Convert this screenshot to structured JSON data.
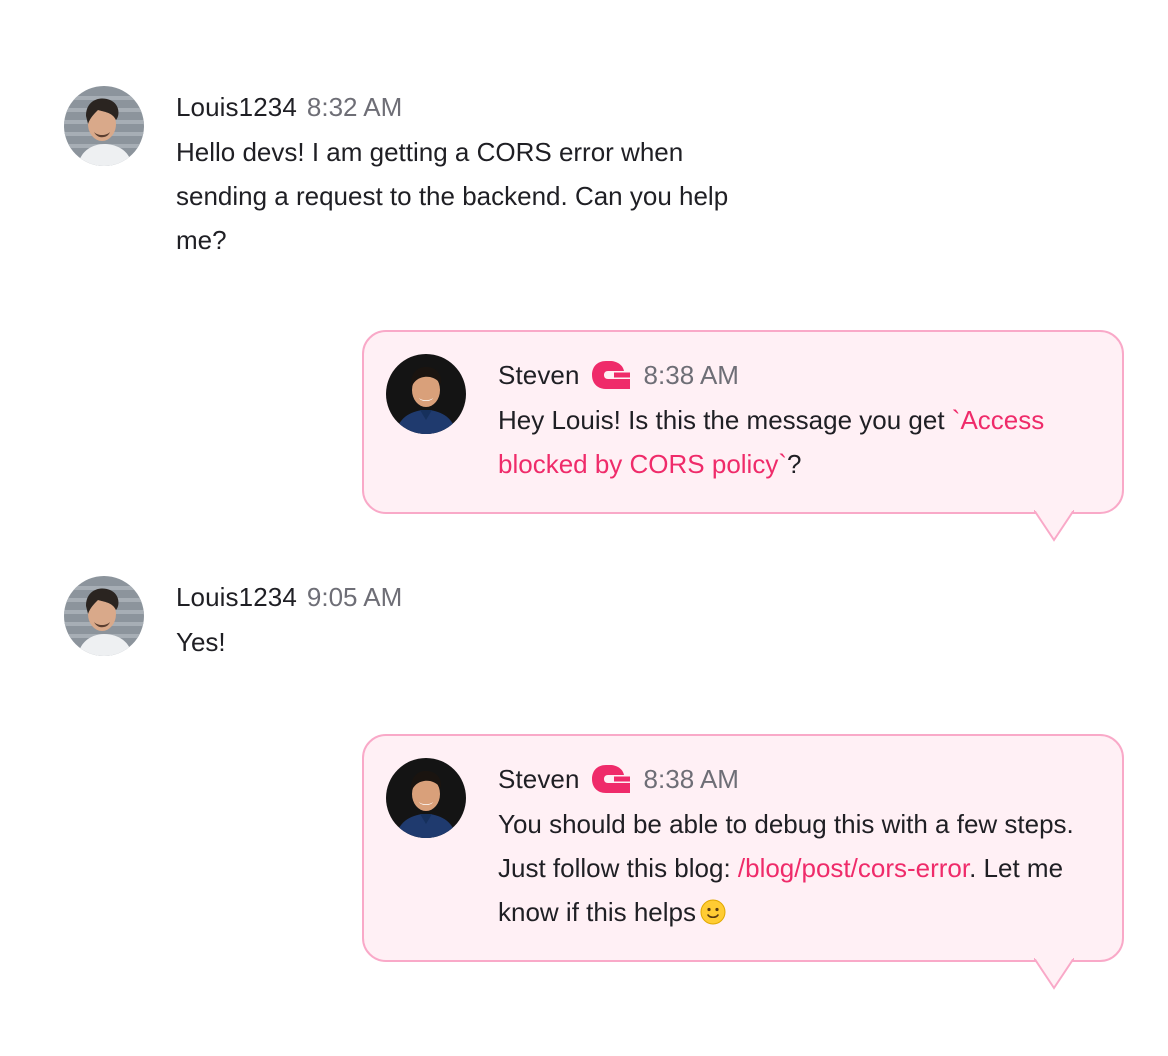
{
  "messages": [
    {
      "author": "Louis1234",
      "time": "8:32 AM",
      "text": "Hello devs! I am getting a CORS error when sending a request to the backend. Can you help me?"
    },
    {
      "author": "Steven",
      "time": "8:38 AM",
      "text_before": "Hey Louis! Is this the message you get ",
      "code": "`Access blocked by CORS policy`",
      "text_after": "?"
    },
    {
      "author": "Louis1234",
      "time": "9:05 AM",
      "text": "Yes!"
    },
    {
      "author": "Steven",
      "time": "8:38 AM",
      "text_before": "You should be able to debug this with a few steps. Just follow this blog: ",
      "link": "/blog/post/cors-error",
      "text_after": ". Let me know if this helps"
    }
  ],
  "icons": {
    "brand": "brand-logo-icon",
    "emoji": "slightly-smiling-face-icon"
  },
  "colors": {
    "accent": "#ef2b6a",
    "bubble_background": "#fff0f5",
    "bubble_border": "#f9a9c8",
    "timestamp": "#6e6e76"
  }
}
